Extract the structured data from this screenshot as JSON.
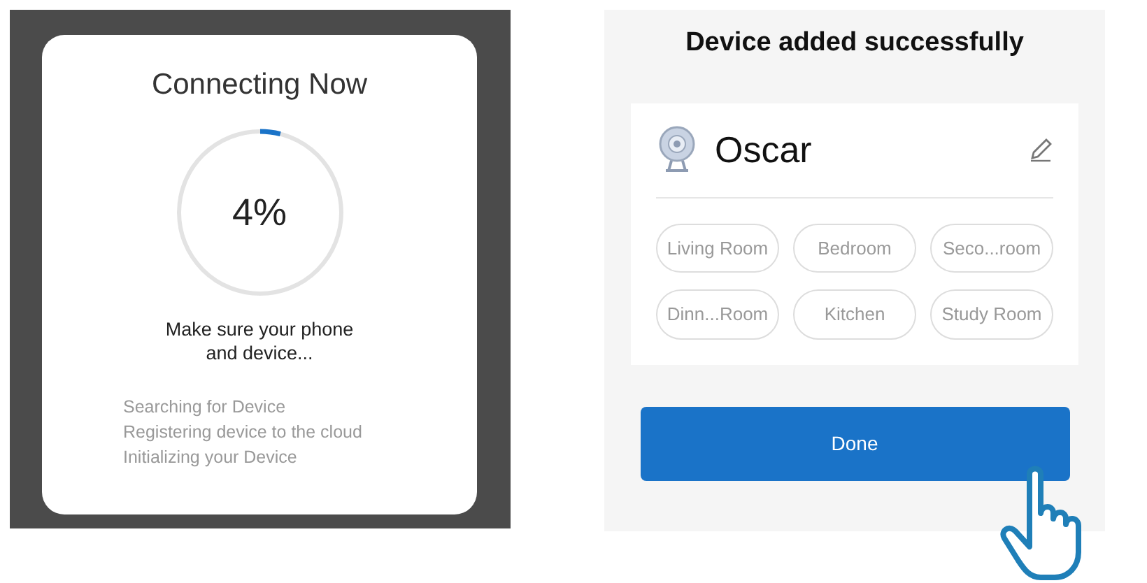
{
  "connecting": {
    "title": "Connecting Now",
    "progress": {
      "reading": "4%"
    },
    "message": "Make sure your phone and device...",
    "steps": [
      "Searching for Device",
      "Registering device to the cloud",
      "Initializing your Device"
    ]
  },
  "added": {
    "title": "Device added successfully",
    "device_name": "Oscar",
    "rooms": [
      {
        "label": "Living Room"
      },
      {
        "label": "Bedroom"
      },
      {
        "label": "Seco...room"
      },
      {
        "label": "Dinn...Room"
      },
      {
        "label": "Kitchen"
      },
      {
        "label": "Study Room"
      }
    ],
    "button": "Done"
  }
}
